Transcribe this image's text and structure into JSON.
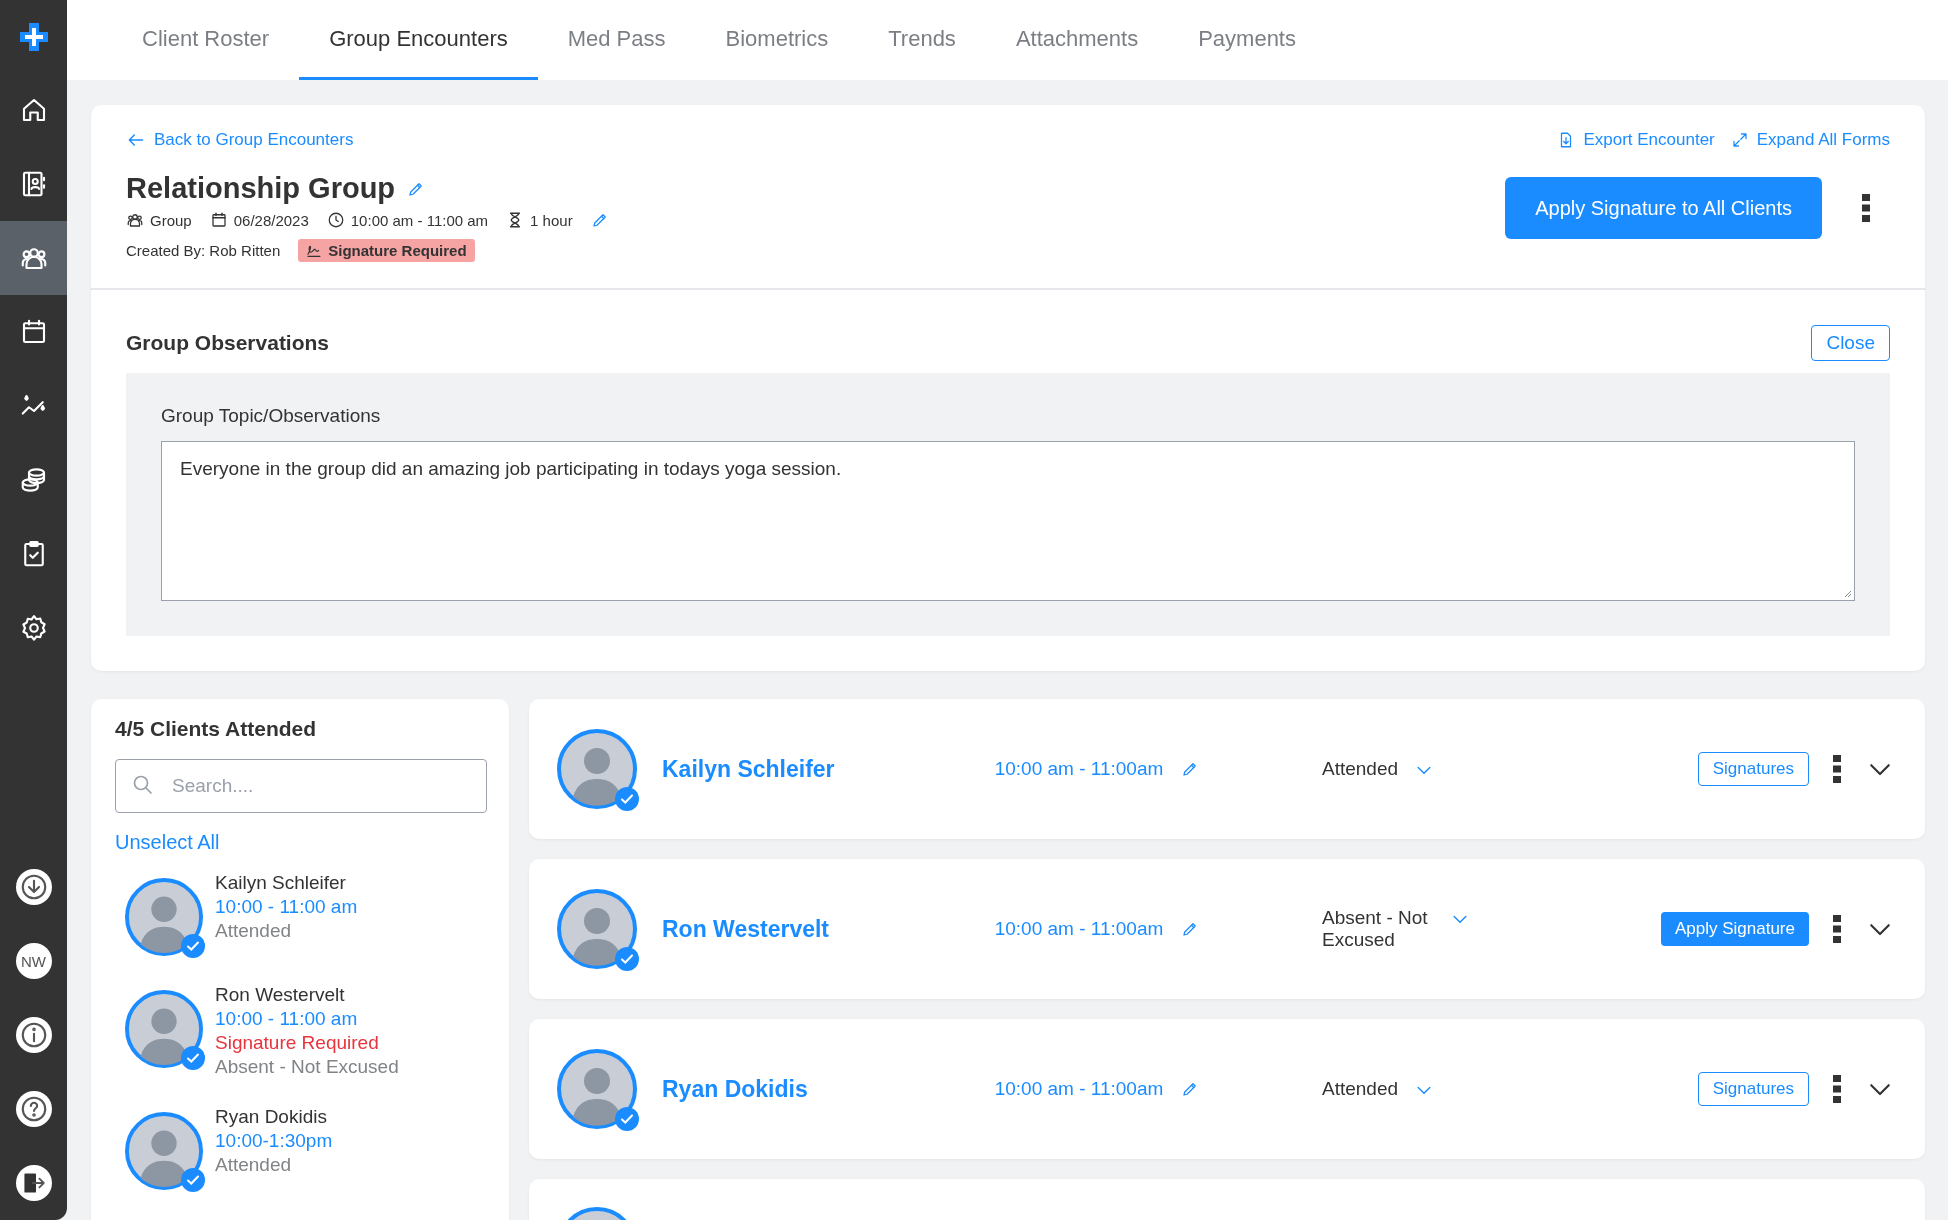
{
  "sidebar": {
    "items": [
      {
        "selected": false
      },
      {
        "selected": false
      },
      {
        "selected": true
      },
      {
        "selected": false
      },
      {
        "selected": false
      },
      {
        "selected": false
      },
      {
        "selected": false
      },
      {
        "selected": false
      }
    ],
    "footer": {
      "initials": "NW"
    }
  },
  "tabs": [
    {
      "label": "Client Roster",
      "selected": false
    },
    {
      "label": "Group Encounters",
      "selected": true
    },
    {
      "label": "Med Pass",
      "selected": false
    },
    {
      "label": "Biometrics",
      "selected": false
    },
    {
      "label": "Trends",
      "selected": false
    },
    {
      "label": "Attachments",
      "selected": false
    },
    {
      "label": "Payments",
      "selected": false
    }
  ],
  "encounter": {
    "back_link": "Back to Group Encounters",
    "title": "Relationship Group",
    "type": "Group",
    "date": "06/28/2023",
    "time": "10:00 am - 11:00 am",
    "duration": "1 hour",
    "created_by": "Created By: Rob Ritten",
    "badge": "Signature Required",
    "export_link": "Export Encounter",
    "expand_link": "Expand All Forms",
    "apply_all_button": "Apply Signature to All Clients"
  },
  "observations": {
    "title": "Group Observations",
    "close_button": "Close",
    "label": "Group Topic/Observations",
    "value": "Everyone in the group did an amazing job participating in todays yoga session."
  },
  "attendance": {
    "title": "4/5 Clients Attended",
    "search": {
      "placeholder": "Search...."
    },
    "unselect_link": "Unselect All",
    "clients": [
      {
        "name": "Kailyn Schleifer",
        "time": "10:00 - 11:00 am",
        "status": "Attended",
        "checked": true
      },
      {
        "name": "Ron Westervelt",
        "time": "10:00 - 11:00 am",
        "note": "Signature Required",
        "status": "Absent - Not Excused",
        "checked": true
      },
      {
        "name": "Ryan Dokidis",
        "time": "10:00-1:30pm",
        "status": "Attended",
        "checked": true
      }
    ]
  },
  "cards": [
    {
      "kind": "client",
      "name": "Kailyn Schleifer",
      "time": "10:00 am - 11:00am",
      "status": "Attended",
      "checked": true,
      "action": {
        "label": "Signatures",
        "kind": "outline"
      }
    },
    {
      "kind": "client",
      "name": "Ron Westervelt",
      "time": "10:00 am - 11:00am",
      "status": "Absent - Not Excused",
      "checked": true,
      "action": {
        "label": "Apply Signature",
        "kind": "filled"
      }
    },
    {
      "kind": "client",
      "name": "Ryan Dokidis",
      "time": "10:00 am - 11:00am",
      "status": "Attended",
      "checked": true,
      "action": {
        "label": "Signatures",
        "kind": "outline"
      }
    },
    {
      "kind": "cut_off"
    }
  ]
}
